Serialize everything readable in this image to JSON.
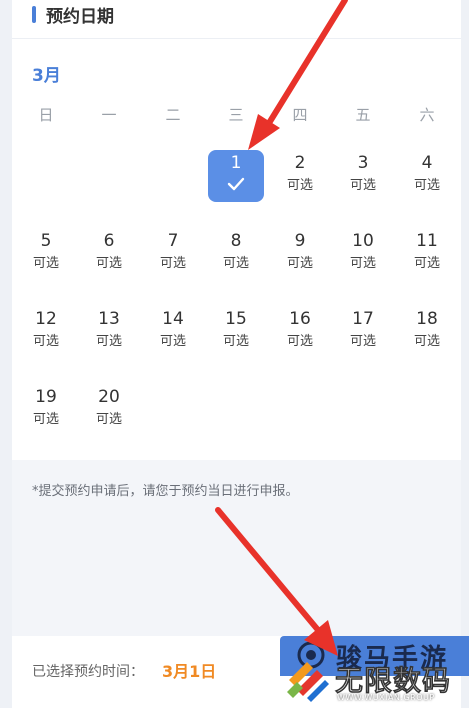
{
  "header": {
    "title": "预约日期"
  },
  "calendar": {
    "month": "3月",
    "weekdays": [
      "日",
      "一",
      "二",
      "三",
      "四",
      "五",
      "六"
    ],
    "available_label": "可选",
    "days": [
      {
        "num": "1",
        "selected": true
      },
      {
        "num": "2",
        "sub": "可选"
      },
      {
        "num": "3",
        "sub": "可选"
      },
      {
        "num": "4",
        "sub": "可选"
      },
      {
        "num": "5",
        "sub": "可选"
      },
      {
        "num": "6",
        "sub": "可选"
      },
      {
        "num": "7",
        "sub": "可选"
      },
      {
        "num": "8",
        "sub": "可选"
      },
      {
        "num": "9",
        "sub": "可选"
      },
      {
        "num": "10",
        "sub": "可选"
      },
      {
        "num": "11",
        "sub": "可选"
      },
      {
        "num": "12",
        "sub": "可选"
      },
      {
        "num": "13",
        "sub": "可选"
      },
      {
        "num": "14",
        "sub": "可选"
      },
      {
        "num": "15",
        "sub": "可选"
      },
      {
        "num": "16",
        "sub": "可选"
      },
      {
        "num": "17",
        "sub": "可选"
      },
      {
        "num": "18",
        "sub": "可选"
      },
      {
        "num": "19",
        "sub": "可选"
      },
      {
        "num": "20",
        "sub": "可选"
      }
    ]
  },
  "notice": {
    "text": "*提交预约申请后，请您于预约当日进行申报。"
  },
  "footer": {
    "label": "已选择预约时间：",
    "value": "3月1日"
  },
  "watermark": {
    "button_text": "骏马手游",
    "brand": "无限数码",
    "site": "WWW.WUXIAN.GROUP"
  },
  "colors": {
    "accent": "#4a7fd8",
    "highlight": "#f08a24",
    "arrow": "#e8322a"
  }
}
